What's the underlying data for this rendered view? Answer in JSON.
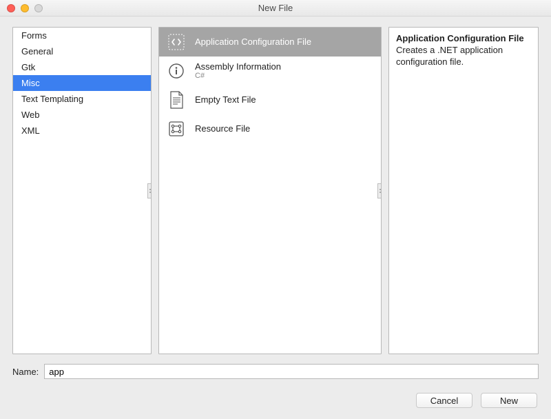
{
  "window": {
    "title": "New File"
  },
  "categories": [
    {
      "label": "Forms"
    },
    {
      "label": "General"
    },
    {
      "label": "Gtk"
    },
    {
      "label": "Misc",
      "selected": true
    },
    {
      "label": "Text Templating"
    },
    {
      "label": "Web"
    },
    {
      "label": "XML"
    }
  ],
  "templates": [
    {
      "label": "Application Configuration File",
      "icon": "code-brackets-icon",
      "selected": true
    },
    {
      "label": "Assembly Information",
      "sublabel": "C#",
      "icon": "info-icon"
    },
    {
      "label": "Empty Text File",
      "icon": "text-file-icon"
    },
    {
      "label": "Resource File",
      "icon": "resource-icon"
    }
  ],
  "description": {
    "title": "Application Configuration File",
    "body": "Creates a .NET application configuration file."
  },
  "name_field": {
    "label": "Name:",
    "value": "app"
  },
  "buttons": {
    "cancel": "Cancel",
    "confirm": "New"
  }
}
